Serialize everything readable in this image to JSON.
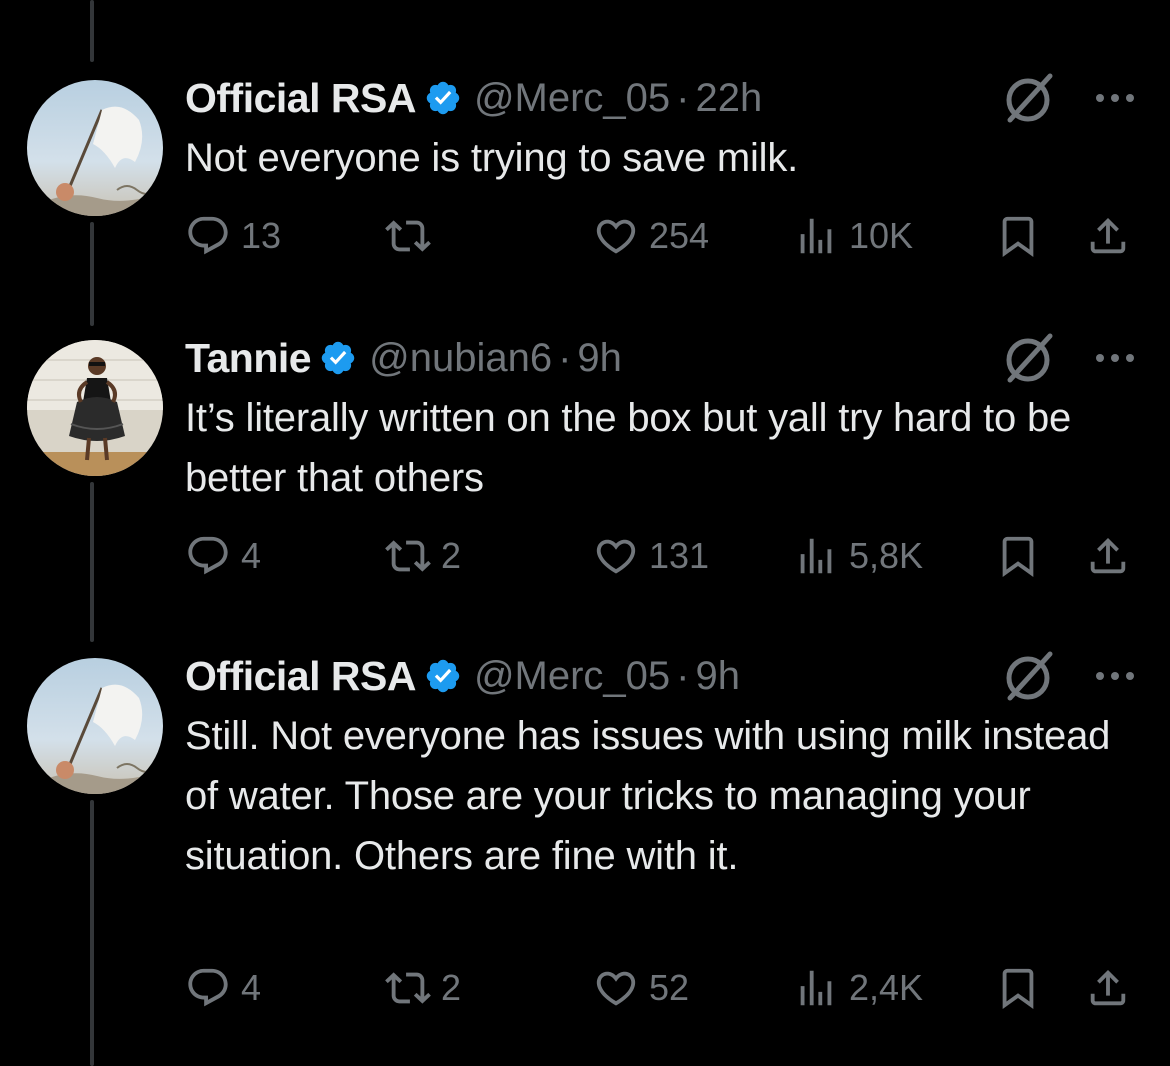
{
  "tweets": [
    {
      "name": "Official RSA",
      "handle": "@Merc_05",
      "time": "22h",
      "text": "Not everyone is trying to save milk.",
      "replies": "13",
      "retweets": "",
      "likes": "254",
      "views": "10K",
      "avatar": "white-flag-avatar"
    },
    {
      "name": "Tannie",
      "handle": "@nubian6",
      "time": "9h",
      "text": "It’s literally written on the box but yall try hard to be better that others",
      "replies": "4",
      "retweets": "2",
      "likes": "131",
      "views": "5,8K",
      "avatar": "woman-in-dress-avatar"
    },
    {
      "name": "Official RSA",
      "handle": "@Merc_05",
      "time": "9h",
      "text": "Still. Not everyone has issues with using milk instead of water. Those are your tricks to managing your situation. Others are fine with it.",
      "replies": "4",
      "retweets": "2",
      "likes": "52",
      "views": "2,4K",
      "avatar": "white-flag-avatar"
    }
  ],
  "separator": "·",
  "colors": {
    "background": "#000000",
    "text": "#e7e9ea",
    "secondary": "#71767b",
    "verified": "#1d9bf0",
    "thread_line": "#333639"
  }
}
